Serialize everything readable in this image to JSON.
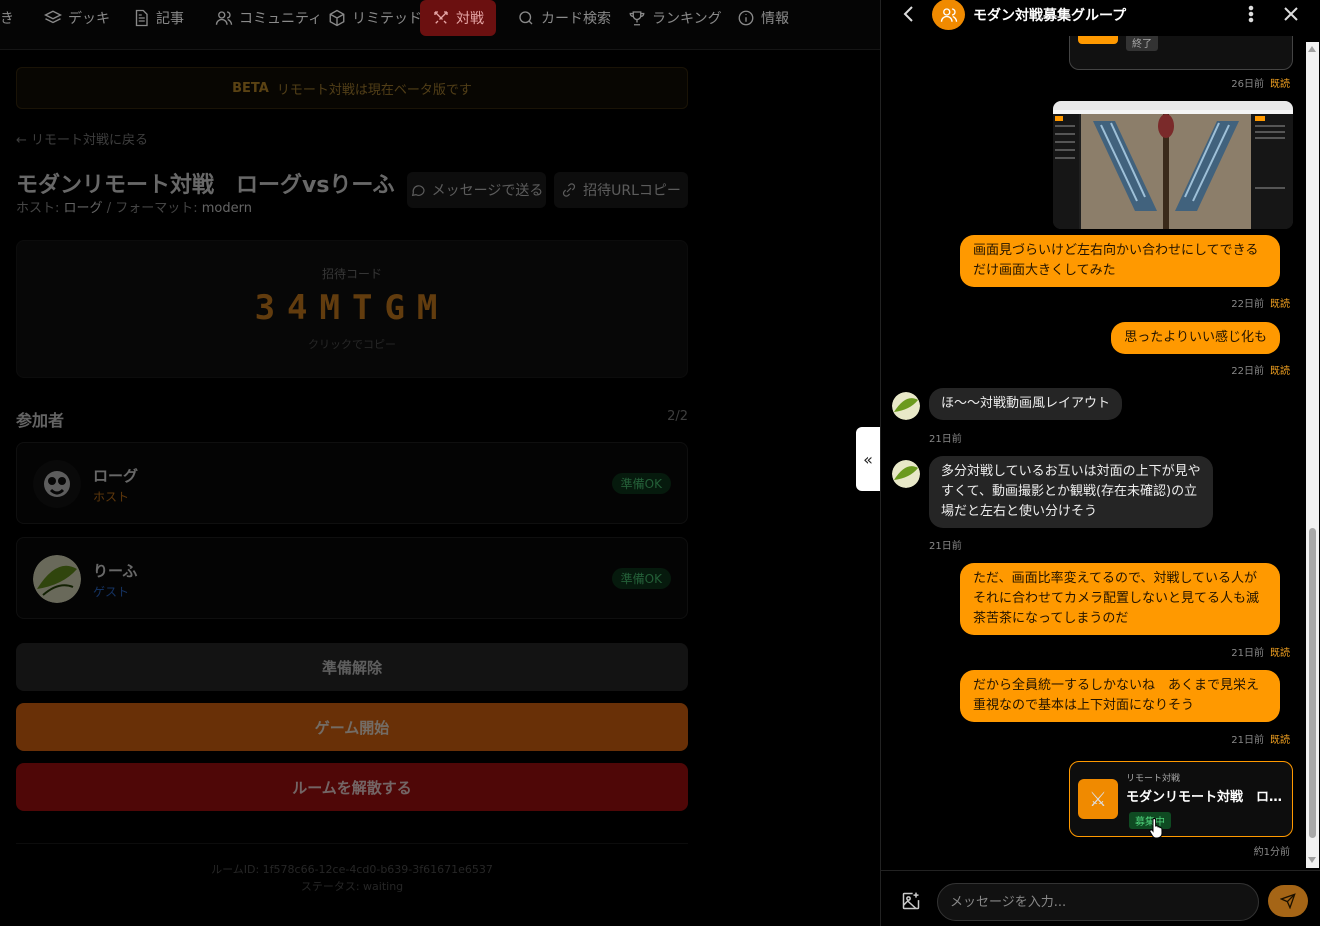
{
  "nav": {
    "items": [
      {
        "label": "き",
        "icon": "partial-item",
        "active": false
      },
      {
        "label": "デッキ",
        "icon": "layers-icon",
        "active": false
      },
      {
        "label": "記事",
        "icon": "document-icon",
        "active": false
      },
      {
        "label": "コミュニティ",
        "icon": "users-icon",
        "active": false
      },
      {
        "label": "リミテッド",
        "icon": "box-icon",
        "active": false
      },
      {
        "label": "対戦",
        "icon": "swords-icon",
        "active": true
      },
      {
        "label": "カード検索",
        "icon": "search-icon",
        "active": false
      },
      {
        "label": "ランキング",
        "icon": "trophy-icon",
        "active": false
      },
      {
        "label": "情報",
        "icon": "info-icon",
        "active": false
      }
    ]
  },
  "room": {
    "beta_tag": "BETA",
    "beta_text": "リモート対戦は現在ベータ版です",
    "back_label": "← リモート対戦に戻る",
    "title": "モダンリモート対戦　ローグvsりーふ",
    "host_label": "ホスト:",
    "host_value": "ローグ",
    "format_label": "/ フォーマット:",
    "format_value": "modern",
    "send_message_label": "メッセージで送る",
    "copy_url_label": "招待URLコピー",
    "invite_code_label": "招待コード",
    "invite_code": "34MTGM",
    "invite_hint": "クリックでコピー",
    "participants_title": "参加者",
    "participants_count": "2/2",
    "participants": [
      {
        "name": "ローグ",
        "role": "ホスト",
        "status": "準備OK"
      },
      {
        "name": "りーふ",
        "role": "ゲスト",
        "status": "準備OK"
      }
    ],
    "cancel_ready_label": "準備解除",
    "start_game_label": "ゲーム開始",
    "dissolve_label": "ルームを解散する",
    "room_id": "ルームID: 1f578c66-12ce-4cd0-b639-3f61671e6537",
    "status": "ステータス: waiting"
  },
  "chat": {
    "title": "モダン対戦募集グループ",
    "ended_badge": "終了",
    "messages": [
      {
        "time": "26日前",
        "read": "既読"
      },
      {
        "text": "画面見づらいけど左右向かい合わせにしてできるだけ画面大きくしてみた",
        "time": "22日前",
        "read": "既読"
      },
      {
        "text": "思ったよりいい感じ化も",
        "time": "22日前",
        "read": "既読"
      },
      {
        "text": "ほ～～対戦動画風レイアウト",
        "time": "21日前"
      },
      {
        "text": "多分対戦しているお互いは対面の上下が見やすくて、動画撮影とか観戦(存在未確認)の立場だと左右と使い分けそう",
        "time": "21日前"
      },
      {
        "text": "ただ、画面比率変えてるので、対戦している人がそれに合わせてカメラ配置しないと見てる人も滅茶苦茶になってしまうのだ",
        "time": "21日前",
        "read": "既読"
      },
      {
        "text": "だから全員統一するしかないね　あくまで見栄え重視なので基本は上下対面になりそう",
        "time": "21日前",
        "read": "既読"
      }
    ],
    "room_share": {
      "type_label": "リモート対戦",
      "title": "モダンリモート対戦　ローグvsりーふ",
      "status_badge": "募集中",
      "time": "約1分前"
    },
    "input_placeholder": "メッセージを入力..."
  },
  "colors": {
    "accent_orange": "#ff9900",
    "active_nav_bg": "#6b1010",
    "ready_green": "#4ed07a",
    "danger_red": "#b01010"
  }
}
